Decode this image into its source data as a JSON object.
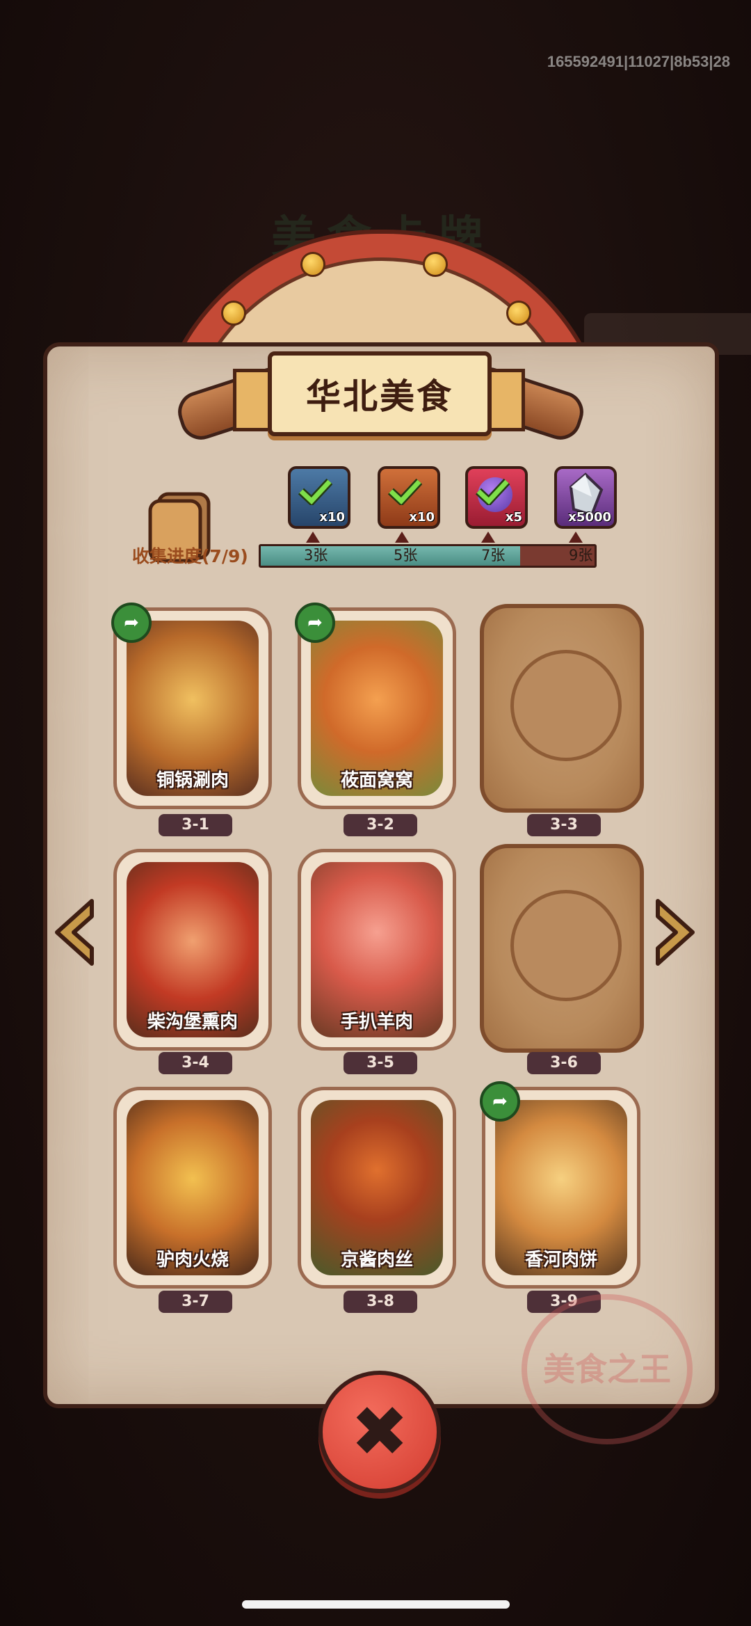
{
  "debug_id": "165592491|11027|8b53|28",
  "background_title": "美食卡牌",
  "title": "华北美食",
  "progress": {
    "label": "收集进度(7/9)",
    "collected": 7,
    "total": 9,
    "milestones": [
      {
        "label": "3张",
        "reward_qty": "x10",
        "reward_icon": "hammer-tool-icon",
        "claimed": true
      },
      {
        "label": "5张",
        "reward_qty": "x10",
        "reward_icon": "wrench-tool-icon",
        "claimed": true
      },
      {
        "label": "7张",
        "reward_qty": "x5",
        "reward_icon": "purple-orb-icon",
        "claimed": true
      },
      {
        "label": "9张",
        "reward_qty": "x5000",
        "reward_icon": "crystal-gem-icon",
        "claimed": false
      }
    ]
  },
  "cards": [
    {
      "id": "3-1",
      "name": "铜锅涮肉",
      "collected": true,
      "shareable": true
    },
    {
      "id": "3-2",
      "name": "莜面窝窝",
      "collected": true,
      "shareable": true
    },
    {
      "id": "3-3",
      "name": "",
      "collected": false,
      "shareable": false
    },
    {
      "id": "3-4",
      "name": "柴沟堡熏肉",
      "collected": true,
      "shareable": false
    },
    {
      "id": "3-5",
      "name": "手扒羊肉",
      "collected": true,
      "shareable": false
    },
    {
      "id": "3-6",
      "name": "",
      "collected": false,
      "shareable": false
    },
    {
      "id": "3-7",
      "name": "驴肉火烧",
      "collected": true,
      "shareable": false
    },
    {
      "id": "3-8",
      "name": "京酱肉丝",
      "collected": true,
      "shareable": false
    },
    {
      "id": "3-9",
      "name": "香河肉饼",
      "collected": true,
      "shareable": true
    }
  ],
  "seal_text": "美食之王",
  "colors": {
    "parchment": "#d9c7b3",
    "progress_fill": "#4a8d84",
    "close_button": "#d33c30",
    "share_button": "#3b8f3a"
  }
}
